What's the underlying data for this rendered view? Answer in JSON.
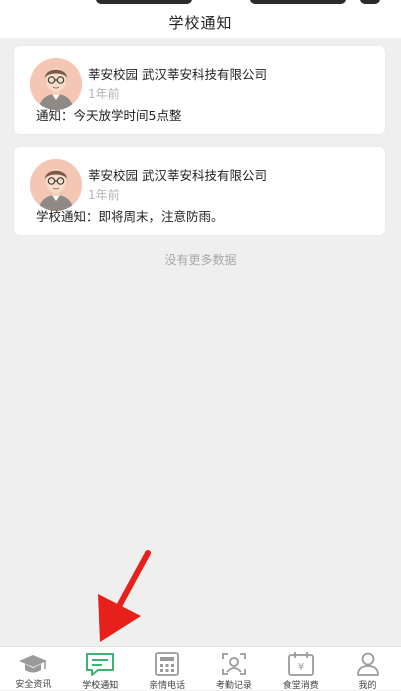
{
  "header": {
    "title": "学校通知"
  },
  "notifications": [
    {
      "sender": "莘安校园 武汉莘安科技有限公司",
      "time": "1年前",
      "message": "通知：今天放学时间5点整"
    },
    {
      "sender": "莘安校园 武汉莘安科技有限公司",
      "time": "1年前",
      "message": "学校通知：即将周末，注意防雨。"
    }
  ],
  "list_footer": "没有更多数据",
  "tabbar": {
    "items": [
      {
        "label": "安全资讯",
        "icon": "graduation-cap-icon",
        "active": false
      },
      {
        "label": "学校通知",
        "icon": "message-icon",
        "active": true
      },
      {
        "label": "亲情电话",
        "icon": "calculator-phone-icon",
        "active": false
      },
      {
        "label": "考勤记录",
        "icon": "face-scan-icon",
        "active": false
      },
      {
        "label": "食堂消费",
        "icon": "yen-calendar-icon",
        "active": false
      },
      {
        "label": "我的",
        "icon": "user-icon",
        "active": false
      }
    ]
  },
  "colors": {
    "accent": "#3cb371",
    "icon_gray": "#9a9a9a",
    "background": "#efefef",
    "annotation_arrow": "#e8201c"
  }
}
